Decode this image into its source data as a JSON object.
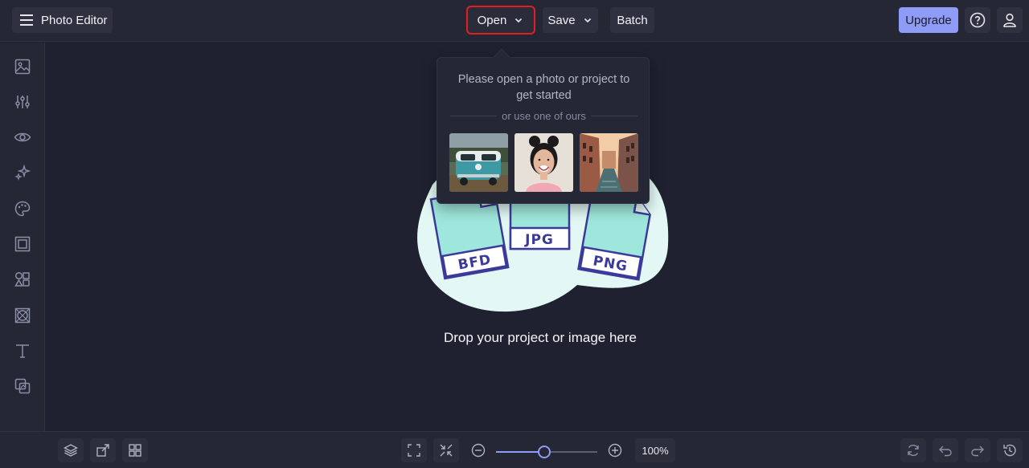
{
  "app": {
    "title": "Photo Editor"
  },
  "toolbar": {
    "open_label": "Open",
    "save_label": "Save",
    "batch_label": "Batch",
    "upgrade_label": "Upgrade"
  },
  "sidebar": {
    "items": [
      {
        "icon": "image-icon"
      },
      {
        "icon": "adjustments-icon"
      },
      {
        "icon": "eye-icon"
      },
      {
        "icon": "sparkles-icon"
      },
      {
        "icon": "palette-icon"
      },
      {
        "icon": "frame-icon"
      },
      {
        "icon": "shapes-icon"
      },
      {
        "icon": "texture-icon"
      },
      {
        "icon": "text-icon"
      },
      {
        "icon": "overlay-icon"
      }
    ]
  },
  "canvas": {
    "drop_text": "Drop your project or image here",
    "file_labels": [
      "BFD",
      "JPG",
      "PNG"
    ]
  },
  "popover": {
    "message": "Please open a photo or project to get started",
    "divider_text": "or use one of ours",
    "samples": [
      "van-photo",
      "woman-portrait-photo",
      "canal-photo"
    ]
  },
  "zoom": {
    "label": "100%",
    "level": 0.48
  },
  "colors": {
    "accent": "#8e9cf7",
    "highlight": "#e02020",
    "blob": "#e3f8f4",
    "file_outline": "#3b3a9a"
  }
}
